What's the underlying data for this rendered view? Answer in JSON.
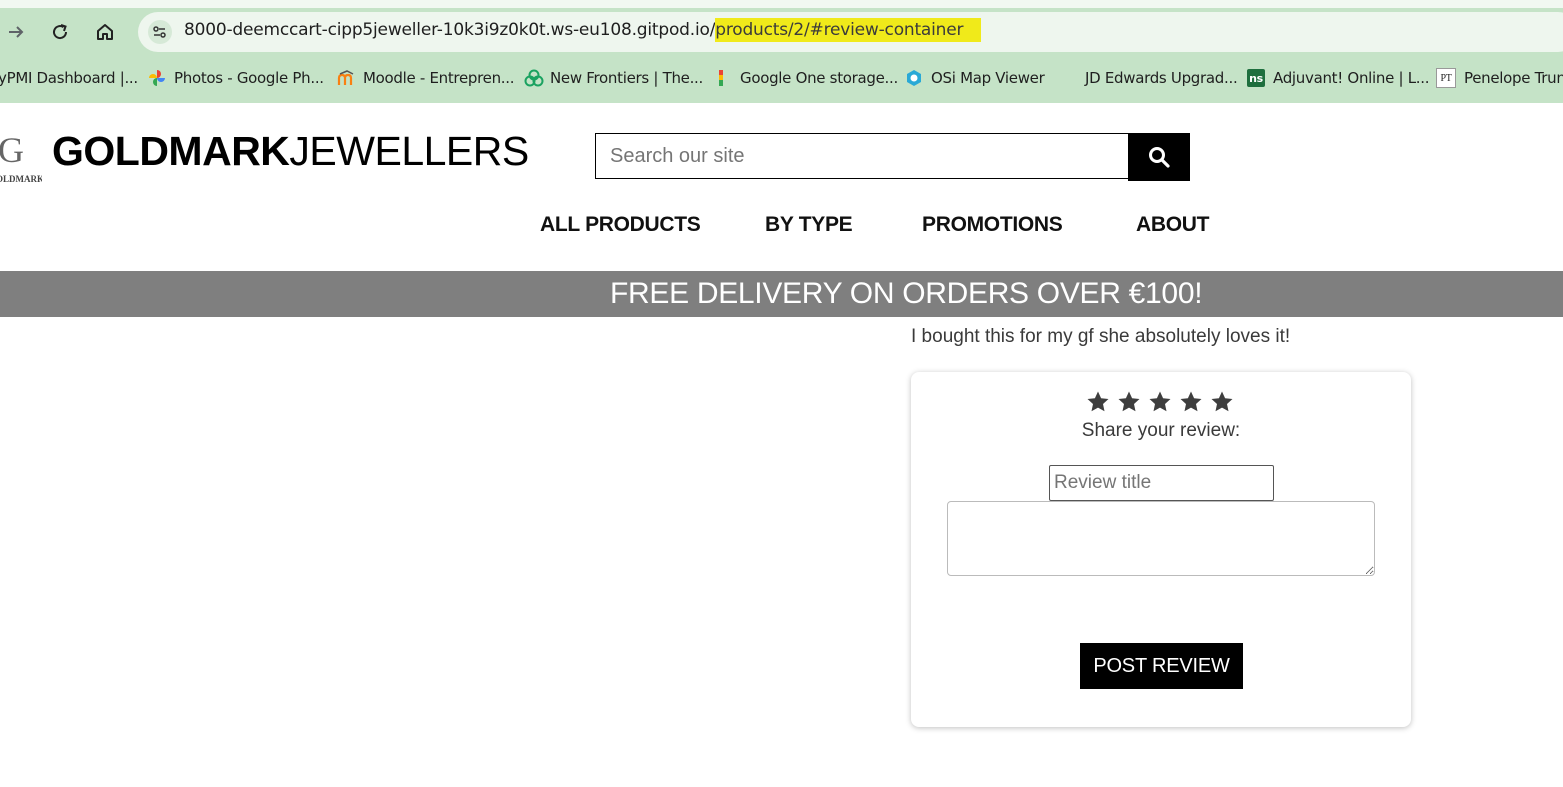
{
  "browser": {
    "url_prefix": "8000-deemccart-cipp5jeweller-10k3i9z0k0t.ws-eu108.gitpod.io/",
    "url_highlight": "products/2/#review-container",
    "bookmarks": [
      {
        "label": "yPMI Dashboard |...",
        "icon": "none"
      },
      {
        "label": "Photos - Google Ph...",
        "icon": "pinwheel-icon"
      },
      {
        "label": "Moodle - Entrepren...",
        "icon": "moodle-icon"
      },
      {
        "label": "New Frontiers | The...",
        "icon": "knot-icon"
      },
      {
        "label": "Google One storage...",
        "icon": "google-one-icon"
      },
      {
        "label": "OSi Map Viewer",
        "icon": "osi-icon"
      },
      {
        "label": "JD Edwards Upgrad...",
        "icon": "none"
      },
      {
        "label": "Adjuvant! Online | L...",
        "icon": "ns-icon"
      },
      {
        "label": "Penelope Trunk",
        "icon": "pt-icon"
      }
    ]
  },
  "header": {
    "logo_letter": "G",
    "logo_caption": "OLDMARK",
    "brand_bold": "GOLDMARK",
    "brand_light": "JEWELLERS",
    "search_placeholder": "Search our site"
  },
  "nav": {
    "items": [
      "ALL PRODUCTS",
      "BY TYPE",
      "PROMOTIONS",
      "ABOUT"
    ]
  },
  "banner": {
    "text": "FREE DELIVERY ON ORDERS OVER €100!"
  },
  "review": {
    "existing_text": "I bought this for my gf she absolutely loves it!",
    "star_count": 5,
    "share_label": "Share your review:",
    "title_placeholder": "Review title",
    "post_label": "POST REVIEW"
  },
  "colors": {
    "chrome_bg": "#c5e3c7",
    "url_highlight": "#f0ea1a",
    "banner_bg": "#7f7f7f",
    "star": "#3e3e3e"
  }
}
